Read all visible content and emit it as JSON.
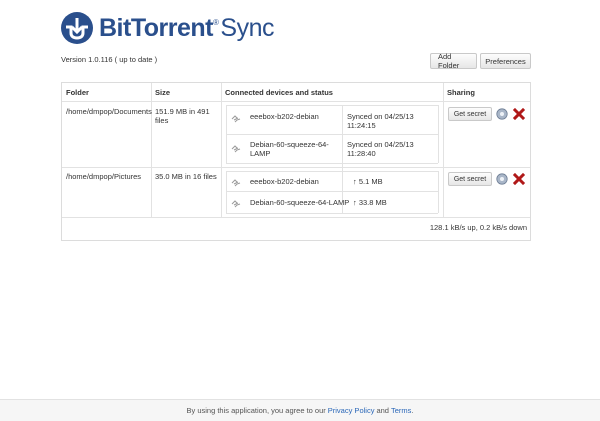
{
  "brand": {
    "name_bold": "BitTorrent",
    "trademark": "®",
    "product": "Sync"
  },
  "version_text": "Version 1.0.116 ( up to date )",
  "toolbar": {
    "add_folder": "Add Folder",
    "preferences": "Preferences"
  },
  "table": {
    "headers": [
      "Folder",
      "Size",
      "Connected devices and status",
      "Sharing"
    ],
    "rows": [
      {
        "folder": "/home/dmpop/Documents",
        "size": "151.9 MB in 491 files",
        "devices": [
          {
            "name": "eeebox-b202-debian",
            "status": "Synced on 04/25/13 11:24:15"
          },
          {
            "name": "Debian-60-squeeze-64-LAMP",
            "status": "Synced on 04/25/13 11:28:40"
          }
        ],
        "secret_label": "Get secret"
      },
      {
        "folder": "/home/dmpop/Pictures",
        "size": "35.0 MB in 16 files",
        "devices": [
          {
            "name": "eeebox-b202-debian",
            "status": "↑ 5.1 MB"
          },
          {
            "name": "Debian-60-squeeze-64-LAMP",
            "status": "↑ 33.8 MB"
          }
        ],
        "secret_label": "Get secret"
      }
    ],
    "speed": "128.1 kB/s up, 0.2 kB/s down"
  },
  "footer": {
    "prefix": "By using this application, you agree to our",
    "privacy": "Privacy Policy",
    "and": "and",
    "terms": "Terms",
    "suffix": "."
  },
  "icons": {
    "link": "link-icon",
    "settings": "gear-icon",
    "remove": "close-icon"
  },
  "colors": {
    "brand": "#2a4f8c",
    "remove": "#b01818",
    "link": "#2a67b8"
  }
}
